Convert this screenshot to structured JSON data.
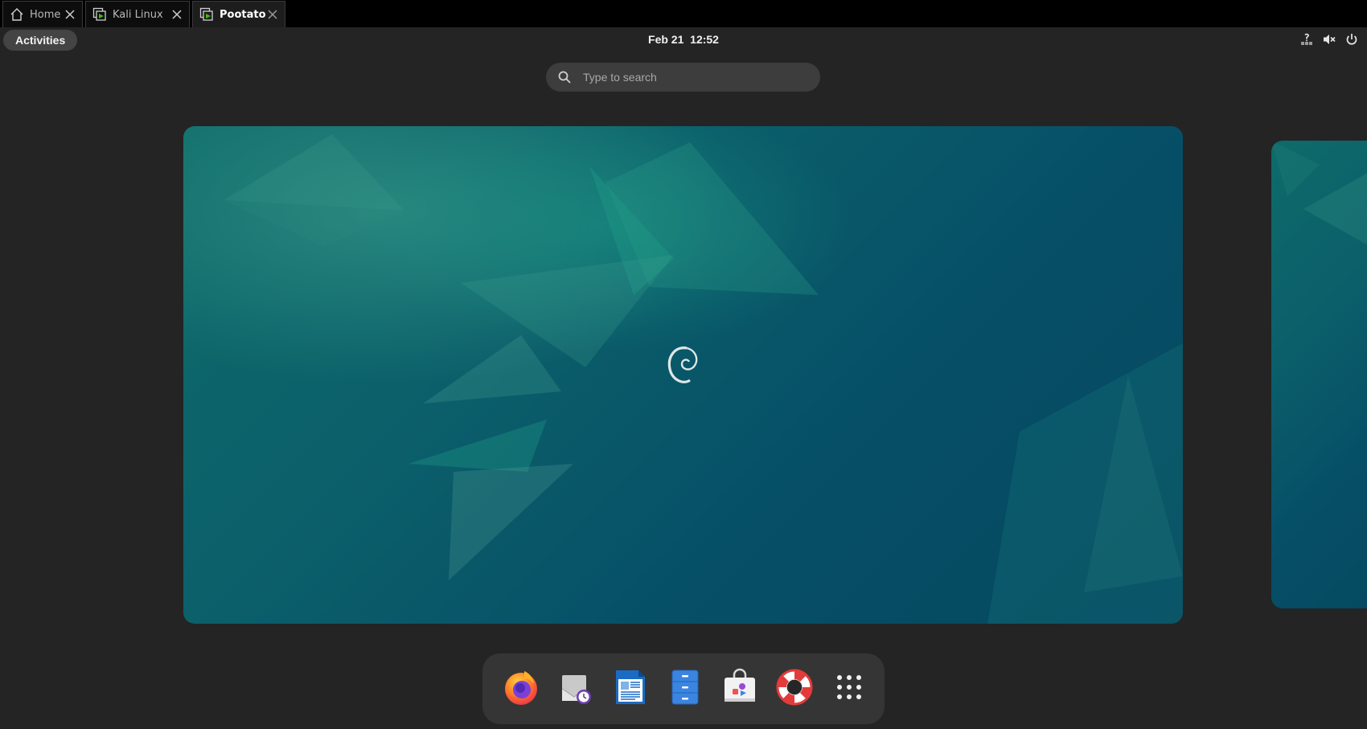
{
  "tabs": [
    {
      "label": "Home",
      "icon": "home-icon"
    },
    {
      "label": "Kali Linux",
      "icon": "vm-icon"
    },
    {
      "label": "Pootato",
      "icon": "vm-icon",
      "active": true
    }
  ],
  "topbar": {
    "activities_label": "Activities",
    "clock": "Feb 21  12:52",
    "tray_icons": [
      "network-unknown-icon",
      "volume-muted-icon",
      "power-icon"
    ]
  },
  "search": {
    "placeholder": "Type to search"
  },
  "workspaces": [
    {
      "name": "workspace-1",
      "active": true
    },
    {
      "name": "workspace-2",
      "active": false
    }
  ],
  "dash": {
    "apps": [
      "firefox-icon",
      "evolution-mail-icon",
      "libreoffice-writer-icon",
      "file-manager-icon",
      "software-center-icon",
      "help-icon",
      "show-apps-icon"
    ]
  },
  "colors": {
    "panel_bg": "#242424",
    "tab_bg": "#000000",
    "wallpaper_teal": "#0e6b6a",
    "wallpaper_blue": "#04485f",
    "accent_green": "#3ec300"
  }
}
